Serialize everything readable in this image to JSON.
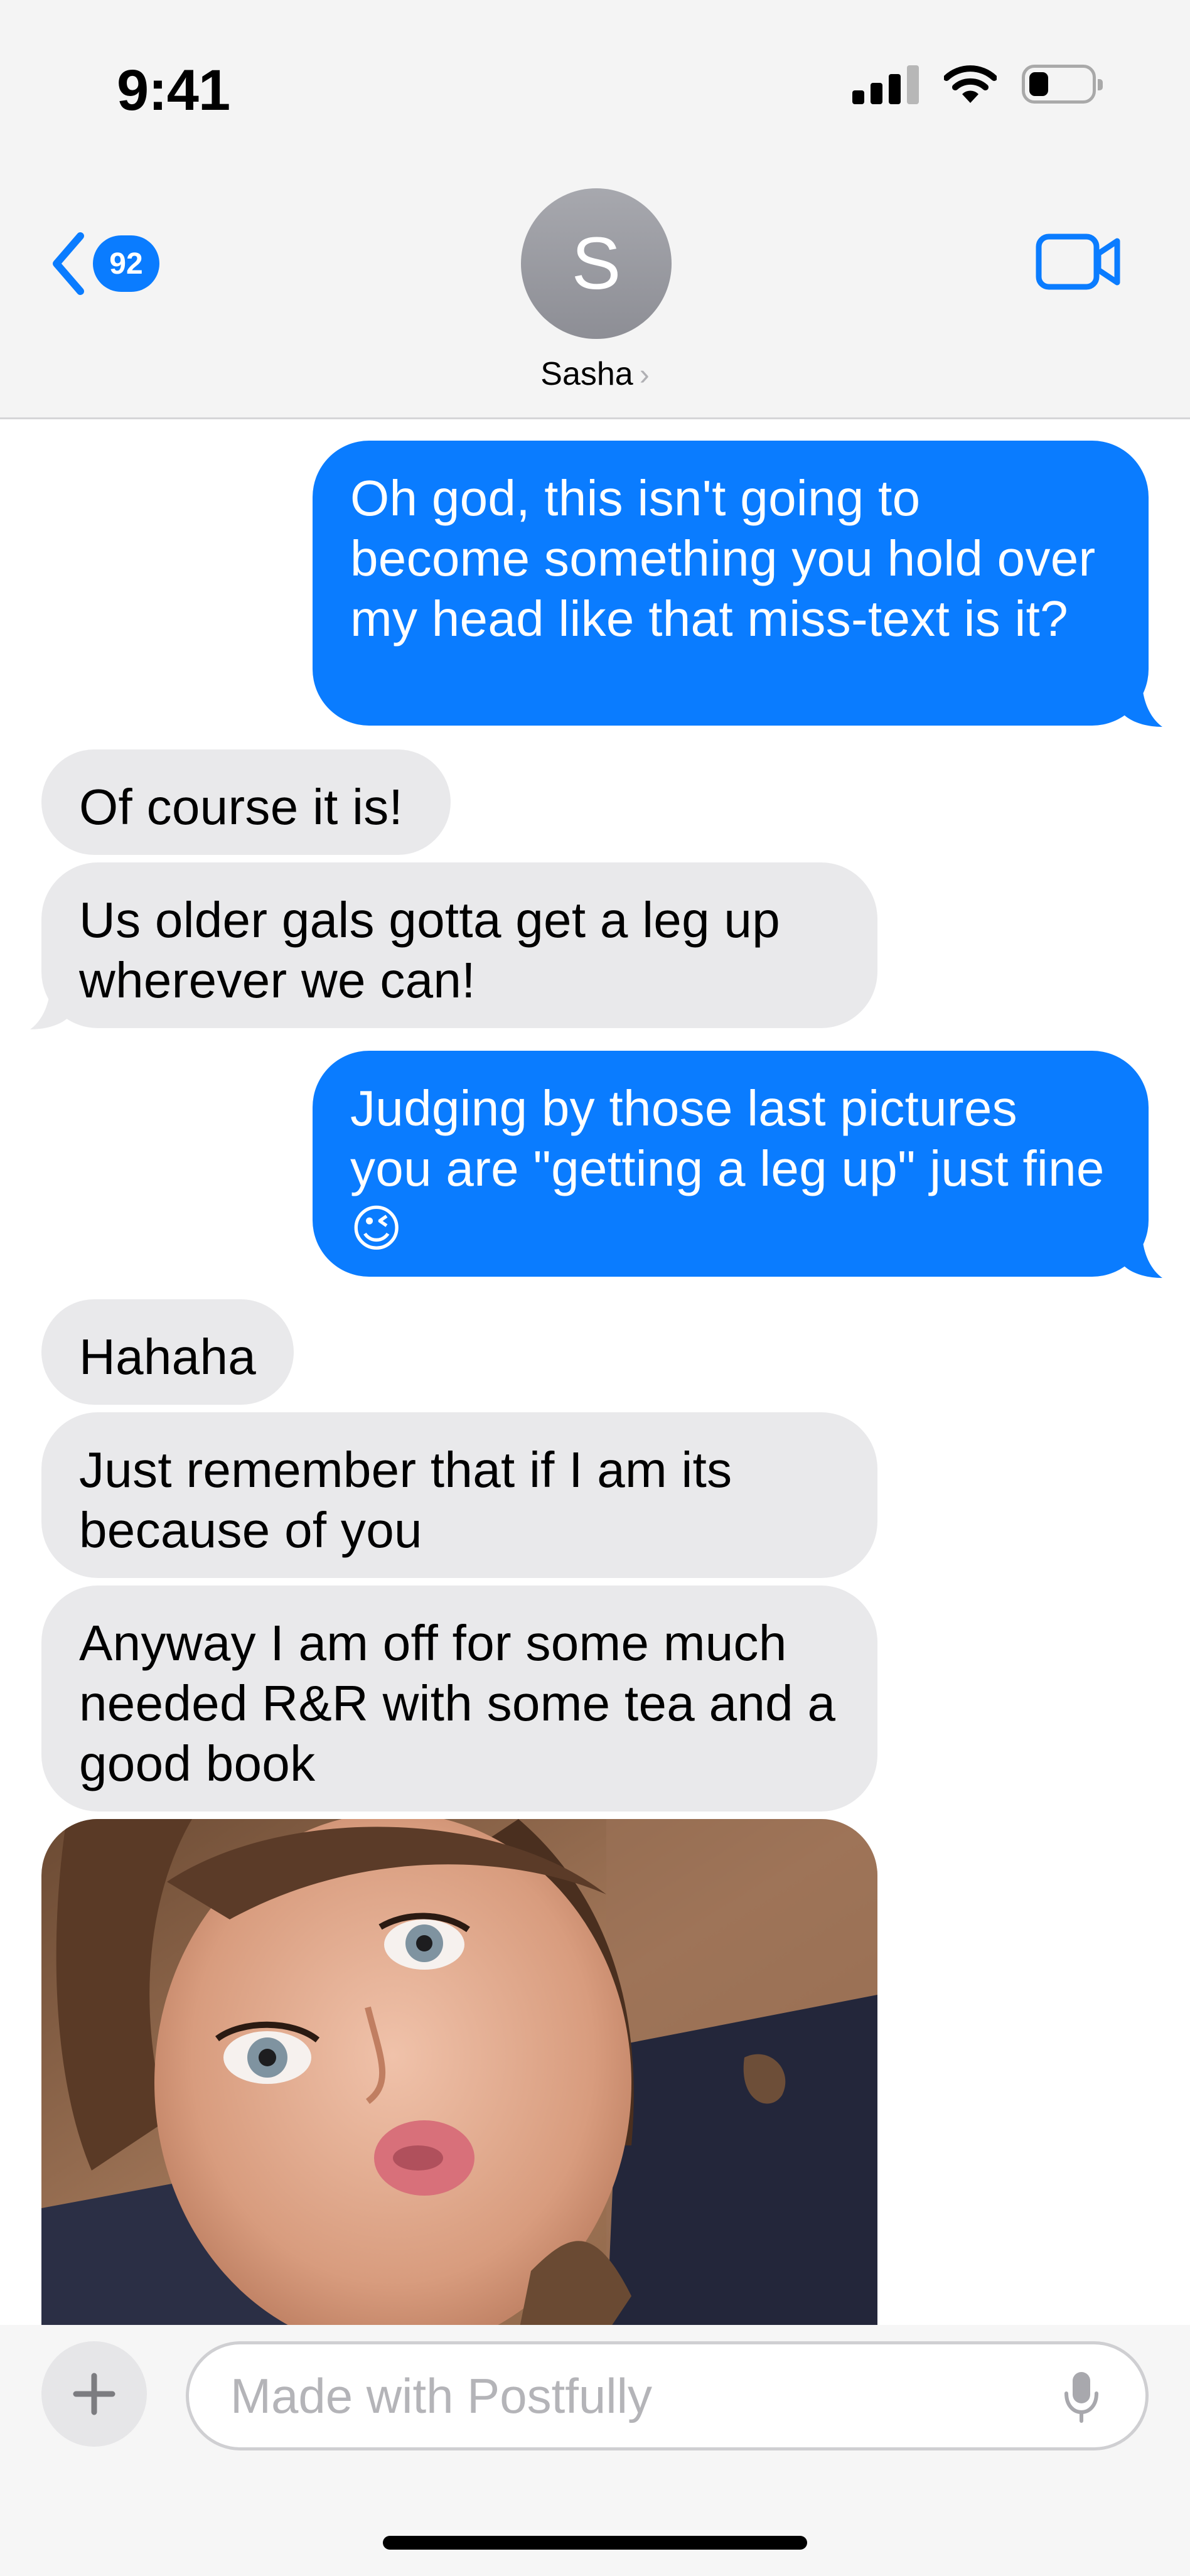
{
  "status_bar": {
    "time": "9:41"
  },
  "nav": {
    "back_count": "92",
    "avatar_initial": "S",
    "contact_name": "Sasha",
    "contact_chevron": "›"
  },
  "messages": [
    {
      "from": "me",
      "text": "Oh god, this isn't going to become something you hold over my head like that miss-text is it?"
    },
    {
      "from": "them",
      "text": "Of course it is!"
    },
    {
      "from": "them",
      "text": "Us older gals gotta get a leg up wherever we can!"
    },
    {
      "from": "me",
      "text": "Judging by those last pictures you are \"getting a leg up\" just fine 😉"
    },
    {
      "from": "them",
      "text": "Hahaha"
    },
    {
      "from": "them",
      "text": "Just remember that if I am its because of you"
    },
    {
      "from": "them",
      "text": "Anyway I am off for some much needed R&R with some tea and a good book"
    }
  ],
  "composer": {
    "placeholder": "Made with Postfully"
  },
  "colors": {
    "outgoing": "#0a7cff",
    "incoming": "#e9e9eb",
    "header": "#f4f4f4"
  },
  "icons": [
    "back-chevron-icon",
    "video-camera-icon",
    "plus-icon",
    "microphone-icon",
    "signal-icon",
    "wifi-icon",
    "battery-icon"
  ]
}
